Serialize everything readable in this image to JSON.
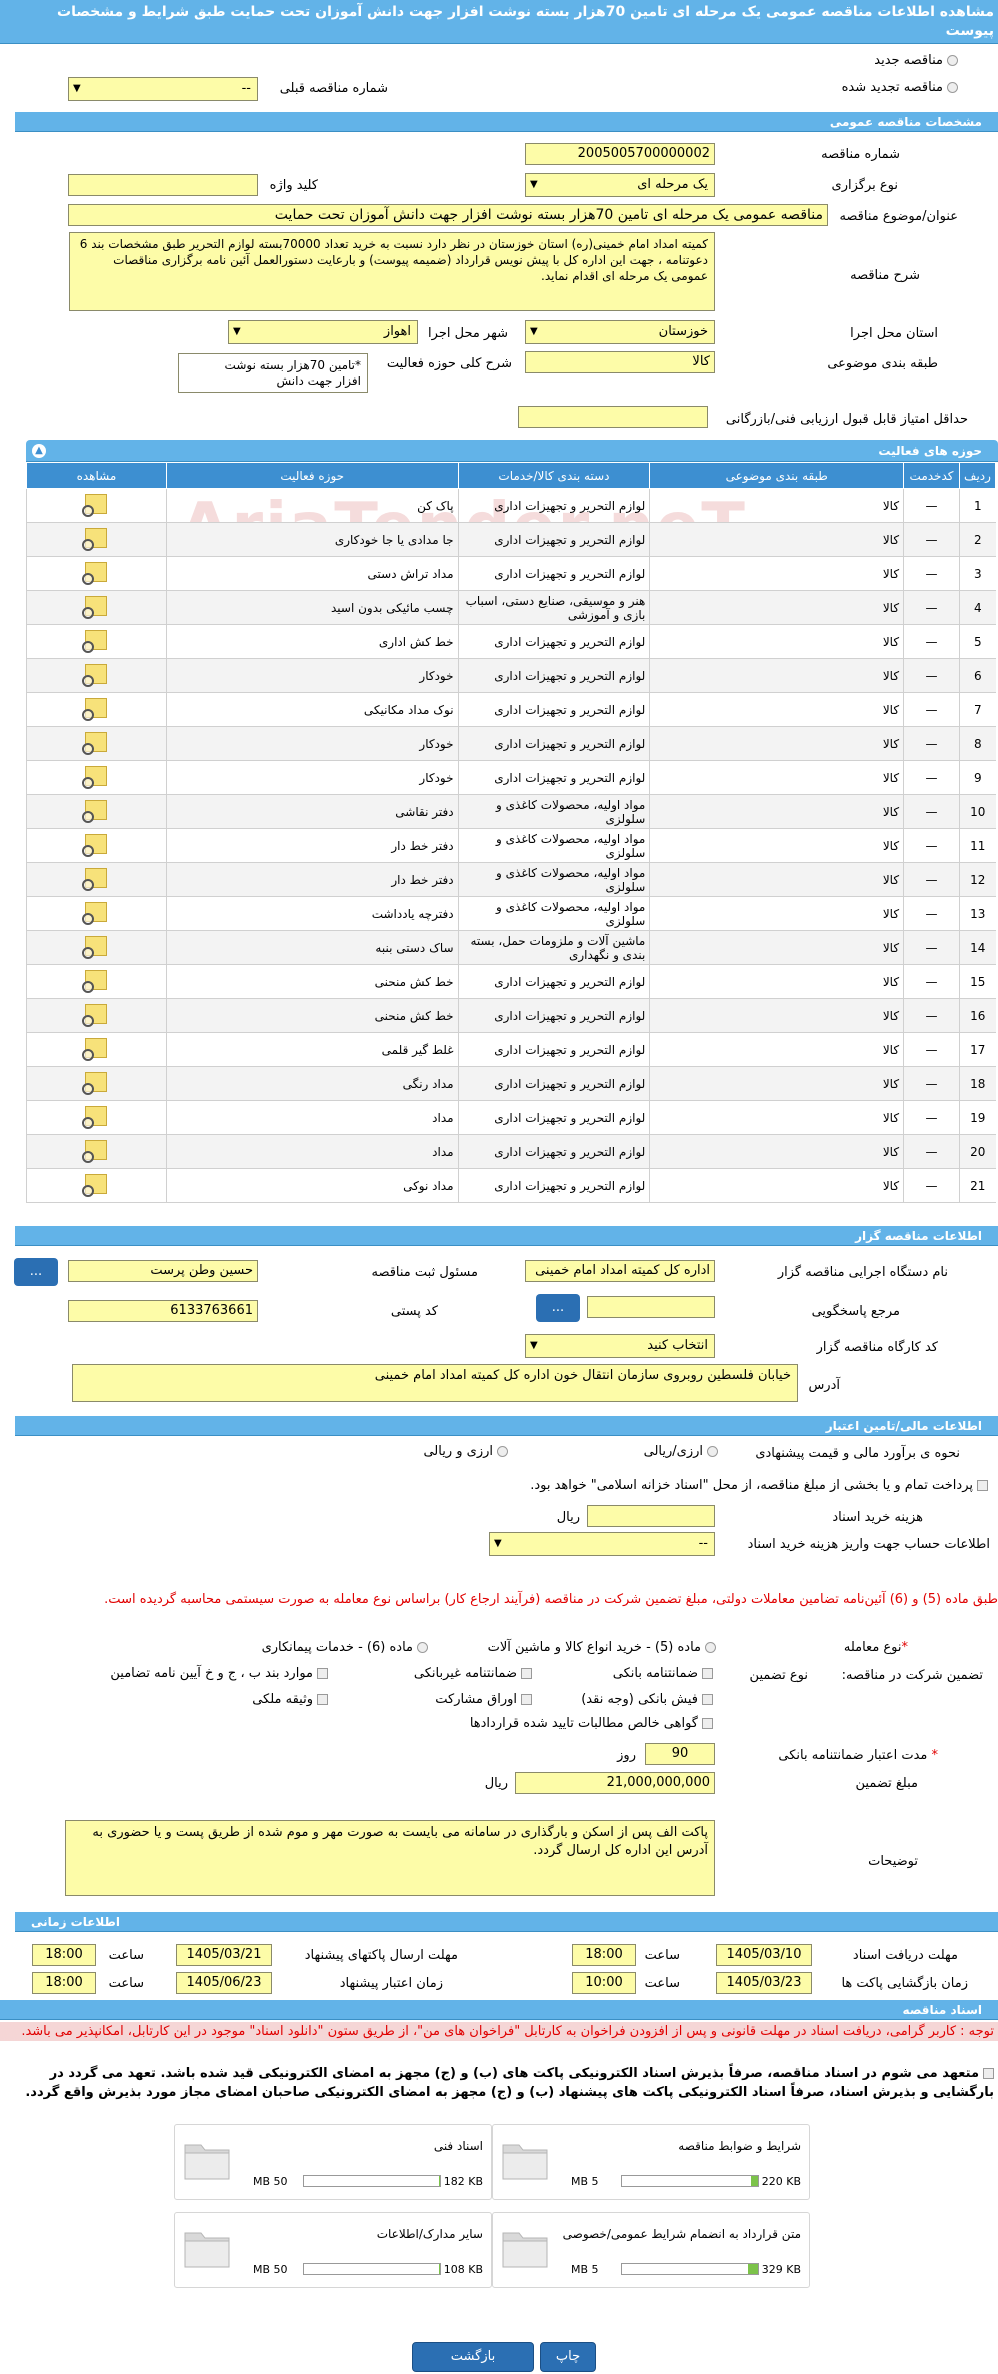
{
  "title": "مشاهده اطلاعات مناقصه عمومی یک مرحله ای تامین 70هزار بسته نوشت افزار جهت دانش آموزان تحت حمایت طبق شرایط و مشخصات پیوست",
  "top": {
    "new_label": "مناقصه جدید",
    "renewed_label": "مناقصه تجدید شده",
    "prev_no_label": "شماره مناقصه قبلی",
    "prev_no_value": "--"
  },
  "general": {
    "header": "مشخصات مناقصه عمومی",
    "number_label": "شماره مناقصه",
    "number": "2005005700000002",
    "type_label": "نوع برگزاری",
    "type": "یک مرحله ای",
    "keyword_label": "کلید واژه",
    "keyword": "",
    "subject_label": "عنوان/موضوع مناقصه",
    "subject": "مناقصه عمومی یک مرحله ای  تامین 70هزار بسته نوشت افزار  جهت دانش آموزان تحت حمایت",
    "desc_label": "شرح مناقصه",
    "desc": "کمیته امداد امام خمینی(ره) استان خوزستان در نظر دارد نسبت به خرید تعداد 70000بسته لوازم التحریر طبق مشخصات بند 6 دعوتنامه ، جهت این اداره کل با پیش نویس قرارداد (ضمیمه پیوست) و بارعایت دستورالعمل آئین نامه برگزاری مناقصات عمومی یک مرحله ای اقدام نماید.",
    "province_label": "استان محل اجرا",
    "province": "خوزستان",
    "city_label": "شهر محل اجرا",
    "city": "اهواز",
    "class_label": "طبقه بندی موضوعی",
    "class": "کالا",
    "activity_label": "شرح کلی حوزه فعالیت",
    "activity": "*تامین 70هزار بسته نوشت افزار  جهت دانش",
    "score_label": "حداقل امتیاز قابل قبول ارزیابی فنی/بازرگانی",
    "score": ""
  },
  "activities": {
    "header": "حوزه های فعالیت",
    "columns": [
      "ردیف",
      "کدخدمت",
      "طبقه بندی موضوعی",
      "دسته بندی کالا/خدمات",
      "حوزه فعالیت",
      "مشاهده"
    ],
    "rows": [
      {
        "n": "1",
        "code": "—",
        "cls": "کالا",
        "cat": "لوازم التحریر و تجهیزات اداری",
        "act": "پاک کن"
      },
      {
        "n": "2",
        "code": "—",
        "cls": "کالا",
        "cat": "لوازم التحریر و تجهیزات اداری",
        "act": "جا مدادی یا جا خودکاری"
      },
      {
        "n": "3",
        "code": "—",
        "cls": "کالا",
        "cat": "لوازم التحریر و تجهیزات اداری",
        "act": "مداد تراش دستی"
      },
      {
        "n": "4",
        "code": "—",
        "cls": "کالا",
        "cat": "هنر و موسیقی، صنایع دستی، اسباب بازی و آموزشی",
        "act": "چسب مائیکی بدون اسید"
      },
      {
        "n": "5",
        "code": "—",
        "cls": "کالا",
        "cat": "لوازم التحریر و تجهیزات اداری",
        "act": "خط کش اداری"
      },
      {
        "n": "6",
        "code": "—",
        "cls": "کالا",
        "cat": "لوازم التحریر و تجهیزات اداری",
        "act": "خودکار"
      },
      {
        "n": "7",
        "code": "—",
        "cls": "کالا",
        "cat": "لوازم التحریر و تجهیزات اداری",
        "act": "نوک مداد مکانیکی"
      },
      {
        "n": "8",
        "code": "—",
        "cls": "کالا",
        "cat": "لوازم التحریر و تجهیزات اداری",
        "act": "خودکار"
      },
      {
        "n": "9",
        "code": "—",
        "cls": "کالا",
        "cat": "لوازم التحریر و تجهیزات اداری",
        "act": "خودکار"
      },
      {
        "n": "10",
        "code": "—",
        "cls": "کالا",
        "cat": "مواد اولیه، محصولات کاغذی و سلولزی",
        "act": "دفتر نقاشی"
      },
      {
        "n": "11",
        "code": "—",
        "cls": "کالا",
        "cat": "مواد اولیه، محصولات کاغذی و سلولزی",
        "act": "دفتر خط دار"
      },
      {
        "n": "12",
        "code": "—",
        "cls": "کالا",
        "cat": "مواد اولیه، محصولات کاغذی و سلولزی",
        "act": "دفتر خط دار"
      },
      {
        "n": "13",
        "code": "—",
        "cls": "کالا",
        "cat": "مواد اولیه، محصولات کاغذی و سلولزی",
        "act": "دفترچه یادداشت"
      },
      {
        "n": "14",
        "code": "—",
        "cls": "کالا",
        "cat": "ماشین آلات و ملزومات حمل، بسته بندی و نگهداری",
        "act": "ساک دستی بنبه"
      },
      {
        "n": "15",
        "code": "—",
        "cls": "کالا",
        "cat": "لوازم التحریر و تجهیزات اداری",
        "act": "خط کش منحنی"
      },
      {
        "n": "16",
        "code": "—",
        "cls": "کالا",
        "cat": "لوازم التحریر و تجهیزات اداری",
        "act": "خط کش منحنی"
      },
      {
        "n": "17",
        "code": "—",
        "cls": "کالا",
        "cat": "لوازم التحریر و تجهیزات اداری",
        "act": "غلط گیر قلمی"
      },
      {
        "n": "18",
        "code": "—",
        "cls": "کالا",
        "cat": "لوازم التحریر و تجهیزات اداری",
        "act": "مداد رنگی"
      },
      {
        "n": "19",
        "code": "—",
        "cls": "کالا",
        "cat": "لوازم التحریر و تجهیزات اداری",
        "act": "مداد"
      },
      {
        "n": "20",
        "code": "—",
        "cls": "کالا",
        "cat": "لوازم التحریر و تجهیزات اداری",
        "act": "مداد"
      },
      {
        "n": "21",
        "code": "—",
        "cls": "کالا",
        "cat": "لوازم التحریر و تجهیزات اداری",
        "act": "مداد نوکی"
      }
    ]
  },
  "organizer": {
    "header": "اطلاعات مناقصه گزار",
    "org_label": "نام دستگاه اجرایی مناقصه گزار",
    "org": "اداره کل کمیته امداد امام خمینی",
    "resp_label": "مسئول ثبت مناقصه",
    "resp": "حسین وطن پرست",
    "ref_label": "مرجع پاسخگویی",
    "ref": "",
    "postal_label": "کد پستی",
    "postal": "6133763661",
    "workshop_label": "کد کارگاه مناقصه گزار",
    "workshop": "انتخاب کنید",
    "address_label": "آدرس",
    "address": "خیابان فلسطین روبروی سازمان انتقال خون اداره کل کمیته امداد امام خمینی",
    "btn": "..."
  },
  "finance": {
    "header": "اطلاعات مالی/تامین اعتبار",
    "method_label": "نحوه ی برآورد مالی و قیمت پیشنهادی",
    "opt1": "ارزی/ریالی",
    "opt2": "ارزی و ریالی",
    "treasury": "پرداخت تمام و یا بخشی از مبلغ مناقصه، از محل \"اسناد خزانه اسلامی\" خواهد بود.",
    "doc_cost_label": "هزینه خرید اسناد",
    "doc_cost_unit": "ریال",
    "account_label": "اطلاعات حساب جهت واریز هزینه خرید اسناد",
    "account": "--"
  },
  "guarantee": {
    "notice": "طبق ماده (5) و (6) آئین‌نامه تضامین معاملات دولتی، مبلغ تضمین شرکت در مناقصه (فرآیند ارجاع کار) براساس نوع معامله به صورت سیستمی محاسبه گردیده است.",
    "deal_label": "نوع معامله",
    "deal1": "ماده (5) - خرید انواع کالا و ماشین آلات",
    "deal2": "ماده (6) - خدمات پیمانکاری",
    "title_label": "تضمین شرکت در مناقصه:",
    "type_label": "نوع تضمین",
    "opts": [
      "ضمانتنامه بانکی",
      "ضمانتنامه غیربانکی",
      "موارد بند ب ، ج و خ آیین نامه تضامین",
      "فیش بانکی (وجه نقد)",
      "اوراق مشارکت",
      "وثیقه ملکی",
      "گواهی خالص مطالبات تایید شده قراردادها"
    ],
    "validity_label": "مدت اعتبار ضمانتنامه بانکی",
    "validity": "90",
    "validity_unit": "روز",
    "amount_label": "مبلغ تضمین",
    "amount": "21,000,000,000",
    "amount_unit": "ریال",
    "desc_label": "توضیحات",
    "desc": "پاکت الف پس از اسکن و بارگذاری در سامانه می بایست به صورت مهر و موم شده از طریق پست و یا حضوری به آدرس این اداره کل ارسال گردد."
  },
  "timing": {
    "header": "اطلاعات زمانی",
    "receive_label": "مهلت دریافت اسناد",
    "receive_date": "1405/03/10",
    "receive_time": "18:00",
    "send_label": "مهلت ارسال پاکتهای پیشنهاد",
    "send_date": "1405/03/21",
    "send_time": "18:00",
    "open_label": "زمان بازگشایی پاکت ها",
    "open_date": "1405/03/23",
    "open_time": "10:00",
    "valid_label": "زمان اعتبار پیشنهاد",
    "valid_date": "1405/06/23",
    "valid_time": "18:00",
    "time_word": "ساعت"
  },
  "docs": {
    "header": "اسناد مناقصه",
    "note": "توجه : کاربر گرامی، دریافت اسناد در مهلت قانونی و پس از افزودن فراخوان به کارتابل \"فراخوان های من\"، از طریق ستون \"دانلود اسناد\" موجود در این کارتابل، امکانپذیر می باشد.",
    "commit": "متعهد می شوم در اسناد مناقصه، صرفاً بذیرش اسناد الکترونیکی پاکت های (ب) و (ج) مجهز به امضای الکترونیکی قید شده باشد. تعهد می گردد در بارگشایی و بذیرش اسناد، صرفاً اسناد الکترونیکی پاکت های پیشنهاد (ب) و (ج) مجهز به امضای الکترونیکی صاحبان امضای مجاز مورد بذیرش واقع گردد.",
    "files": [
      {
        "name": "شرایط و ضوابط مناقصه",
        "size": "220 KB",
        "max": "5 MB",
        "fill": 0.05
      },
      {
        "name": "اسناد فنی",
        "size": "182 KB",
        "max": "50 MB",
        "fill": 0.01
      },
      {
        "name": "متن قرارداد به انضمام شرایط عمومی/خصوصی",
        "size": "329 KB",
        "max": "5 MB",
        "fill": 0.07
      },
      {
        "name": "سایر مدارک/اطلاعات",
        "size": "108 KB",
        "max": "50 MB",
        "fill": 0.01
      }
    ]
  },
  "footer": {
    "print": "چاپ",
    "back": "بازگشت"
  },
  "watermark": "AriaTender.neT",
  "colors": {
    "header_bar": "#62b3e8",
    "table_header": "#3d8fd1",
    "field_bg": "#fdfca8",
    "button": "#2b6fb3",
    "notice_red": "#e00000"
  }
}
